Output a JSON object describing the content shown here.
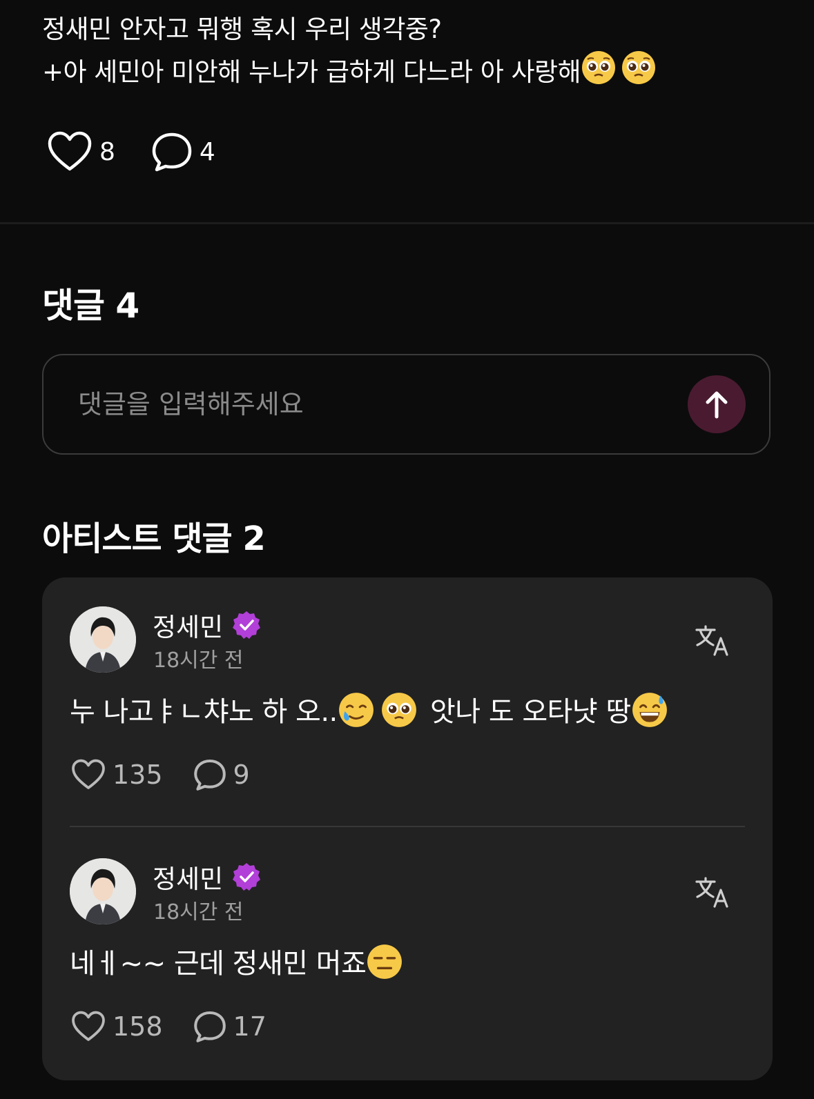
{
  "post": {
    "line1": "정새민 안자고 뭐행 혹시 우리 생각중?",
    "line2": "+아 세민아 미안해 누나가 급하게 다느라 아 사랑해",
    "line2_emojis": [
      "pleading-face",
      "pleading-face"
    ],
    "likes": "8",
    "comments": "4"
  },
  "comments_section": {
    "title": "댓글 4",
    "input_placeholder": "댓글을 입력해주세요",
    "send_icon": "arrow-up-icon",
    "accent_color": "#4a1b30"
  },
  "artist_section": {
    "title": "아티스트 댓글 2",
    "items": [
      {
        "name": "정세민",
        "verified": true,
        "time": "18시간 전",
        "text_a": "누 나고ㅑㄴ챠노 하 오..",
        "text_b": "앗나 도 오타냣 땅",
        "emojis": [
          "smiling-face-with-tear",
          "pleading-face",
          "grinning-face-with-sweat"
        ],
        "likes": "135",
        "replies": "9"
      },
      {
        "name": "정세민",
        "verified": true,
        "time": "18시간 전",
        "text_a": "네ㅔ~~ 근데 정새민 머죠",
        "emojis": [
          "expressionless-face"
        ],
        "likes": "158",
        "replies": "17"
      }
    ]
  },
  "colors": {
    "background": "#0c0c0c",
    "card": "#222222",
    "verified_badge": "#b23fd8"
  }
}
